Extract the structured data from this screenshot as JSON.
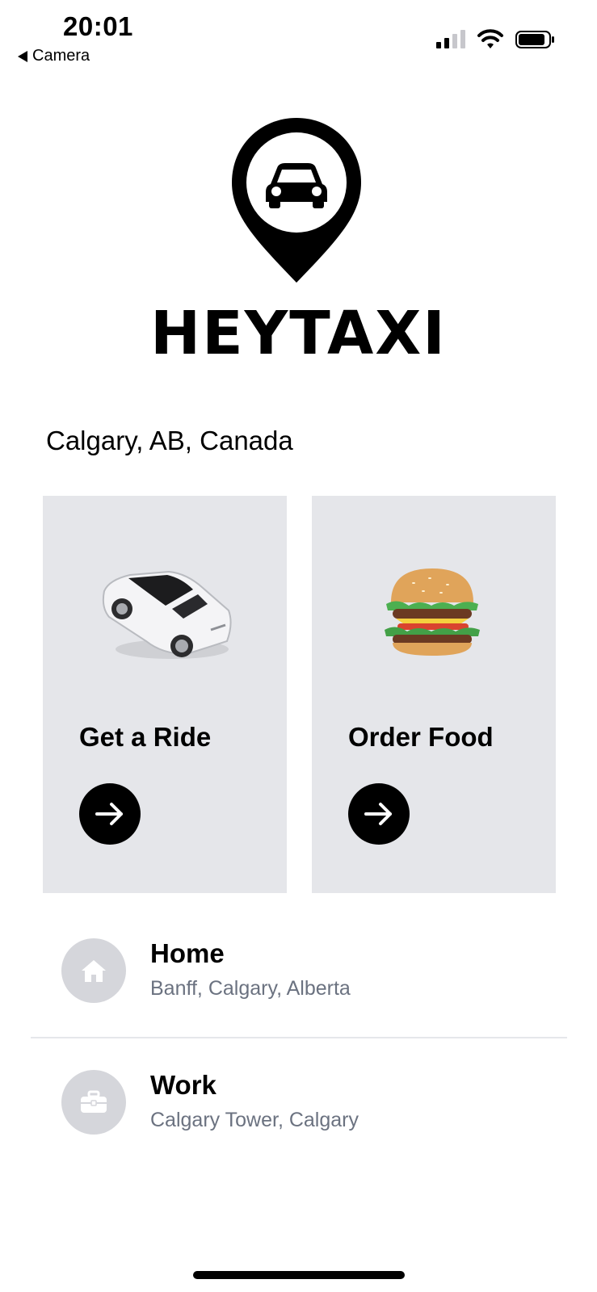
{
  "status_bar": {
    "time": "20:01",
    "back_label": "Camera",
    "icons": [
      "cellular-signal-icon",
      "wifi-icon",
      "battery-icon"
    ]
  },
  "brand": {
    "logo_icon": "map-pin-car-icon",
    "name": "HEYTAXI"
  },
  "location": "Calgary, AB, Canada",
  "cards": [
    {
      "title": "Get a Ride",
      "image": "sports-car-image",
      "action_icon": "arrow-right-icon"
    },
    {
      "title": "Order Food",
      "image": "burger-image",
      "action_icon": "arrow-right-icon"
    }
  ],
  "places": [
    {
      "title": "Home",
      "subtitle": "Banff, Calgary, Alberta",
      "icon": "home-icon"
    },
    {
      "title": "Work",
      "subtitle": "Calgary Tower, Calgary",
      "icon": "briefcase-icon"
    }
  ],
  "colors": {
    "card_background": "#e5e6ea",
    "place_icon_background": "#d5d6db",
    "subtitle_text": "#6b7280",
    "primary": "#000000"
  }
}
